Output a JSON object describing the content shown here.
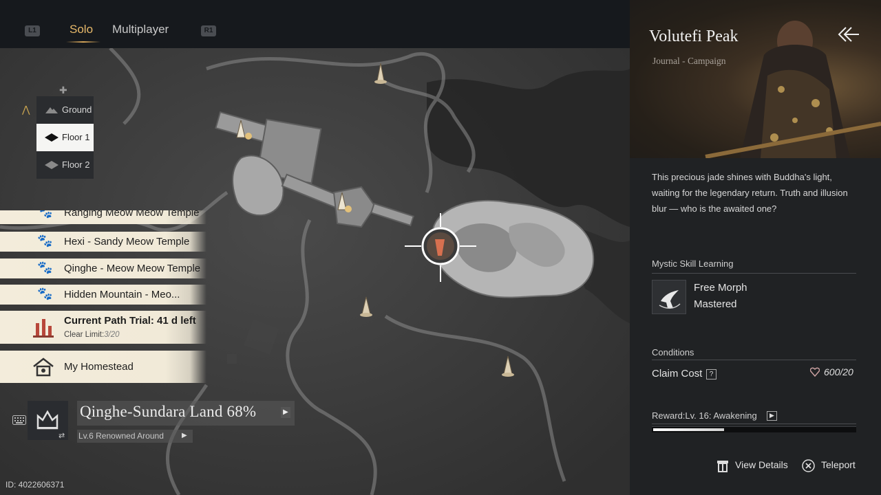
{
  "header": {
    "left_shoulder": "L1",
    "right_shoulder": "R1",
    "tabs": [
      {
        "label": "Solo",
        "active": true
      },
      {
        "label": "Multiplayer",
        "active": false
      }
    ]
  },
  "floors": {
    "items": [
      {
        "label": "Ground",
        "active": false
      },
      {
        "label": "Floor 1",
        "active": true
      },
      {
        "label": "Floor 2",
        "active": false
      }
    ]
  },
  "locations": [
    {
      "label": "Ranging Meow Meow Temple"
    },
    {
      "label": "Hexi - Sandy Meow Temple"
    },
    {
      "label": "Qinghe - Meow Meow Temple"
    },
    {
      "label": "Hidden Mountain - Meo..."
    }
  ],
  "path_trial": {
    "title": "Current Path Trial: 41 d left",
    "limit_label": "Clear Limit:",
    "limit_value": "3/20"
  },
  "homestead": {
    "label": "My Homestead"
  },
  "region": {
    "name": "Qinghe-Sundara Land 68%",
    "progress": 68,
    "renown": "Lv.6 Renowned Around"
  },
  "player_id": "ID: 4022606371",
  "panel": {
    "title": "Volutefi Peak",
    "subtitle": "Journal - Campaign",
    "description": "This precious jade shines with Buddha's light, waiting for the legendary return. Truth and illusion blur — who is the awaited one?",
    "skill_section": "Mystic Skill Learning",
    "skill_name": "Free Morph",
    "skill_status": "Mastered",
    "conditions_section": "Conditions",
    "claim_label": "Claim Cost",
    "claim_help": "?",
    "claim_value": "600/20",
    "reward_label": "Reward:Lv. 16: Awakening",
    "reward_progress": 0.35,
    "actions": {
      "view_details": "View Details",
      "teleport": "Teleport"
    }
  },
  "colors": {
    "accent": "#e7b96a",
    "panel_bg": "#202224",
    "list_bg": "#f1ead8"
  },
  "icons": [
    "paw-icon",
    "path-trial-icon",
    "homestead-icon",
    "keyboard-icon",
    "region-emblem-icon",
    "swap-icon",
    "back-arrow-icon",
    "free-morph-skill-icon",
    "heart-cost-icon",
    "view-details-icon",
    "teleport-x-icon",
    "map-waypoint-marker",
    "map-target-crosshair"
  ]
}
